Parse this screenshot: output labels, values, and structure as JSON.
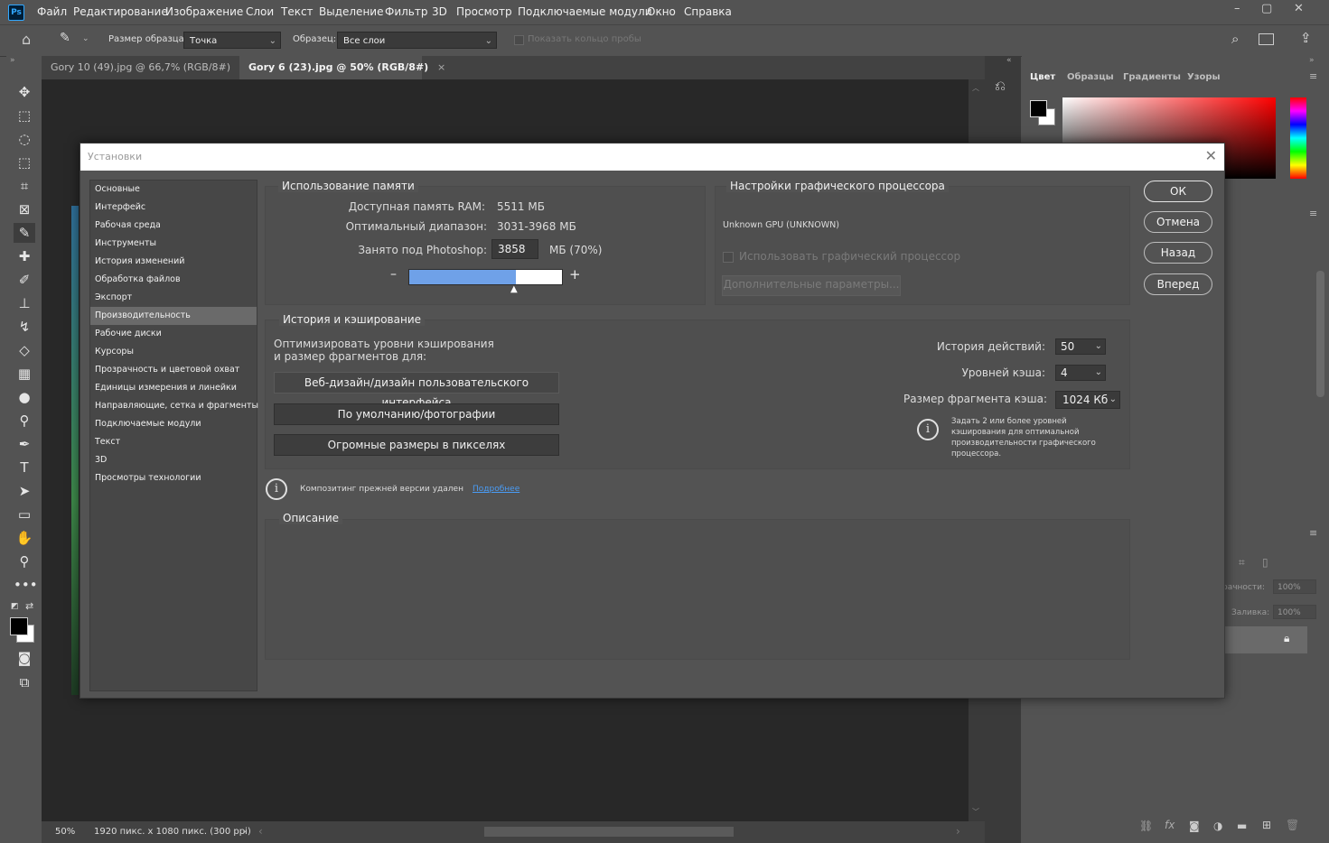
{
  "app": {
    "logo": "Ps",
    "menu": [
      "Файл",
      "Редактирование",
      "Изображение",
      "Слои",
      "Текст",
      "Выделение",
      "Фильтр",
      "3D",
      "Просмотр",
      "Подключаемые модули",
      "Окно",
      "Справка"
    ],
    "window_controls": [
      "–",
      "▢",
      "✕"
    ]
  },
  "options_bar": {
    "sample_size_label": "Размер образца:",
    "sample_size_value": "Точка",
    "sample_label": "Образец:",
    "sample_value": "Все слои",
    "show_ring_label": "Показать кольцо пробы"
  },
  "tabs": [
    {
      "label": "Gory 10 (49).jpg @ 66,7% (RGB/8#)",
      "active": false
    },
    {
      "label": "Gory 6 (23).jpg @ 50% (RGB/8#)",
      "active": true
    }
  ],
  "status_bar": {
    "zoom": "50%",
    "doc_info": "1920 пикс. x 1080 пикс. (300 ppi)"
  },
  "panels": {
    "color_tabs": [
      "Цвет",
      "Образцы",
      "Градиенты",
      "Узоры"
    ],
    "layers_opacity_label": "рачности:",
    "layers_opacity_value": "100%",
    "layers_fill_label": "Заливка:",
    "layers_fill_value": "100%"
  },
  "dialog": {
    "title": "Установки",
    "nav": [
      "Основные",
      "Интерфейс",
      "Рабочая среда",
      "Инструменты",
      "История изменений",
      "Обработка файлов",
      "Экспорт",
      "Производительность",
      "Рабочие диски",
      "Курсоры",
      "Прозрачность и цветовой охват",
      "Единицы измерения и линейки",
      "Направляющие, сетка и фрагменты",
      "Подключаемые модули",
      "Текст",
      "3D",
      "Просмотры технологии"
    ],
    "active_nav": "Производительность",
    "memory": {
      "title": "Использование памяти",
      "ram_label": "Доступная память RAM:",
      "ram_value": "5511 МБ",
      "range_label": "Оптимальный диапазон:",
      "range_value": "3031-3968 МБ",
      "used_label": "Занято под Photoshop:",
      "used_value": "3858",
      "used_unit": "МБ (70%)",
      "used_percent": 70,
      "minus": "–",
      "plus": "+"
    },
    "gpu": {
      "title": "Настройки графического процессора",
      "gpu_name": "Unknown GPU (UNKNOWN)",
      "use_gpu_label": "Использовать графический процессор",
      "advanced_label": "Дополнительные параметры..."
    },
    "history": {
      "title": "История и кэширование",
      "optimize_line1": "Оптимизировать уровни кэширования",
      "optimize_line2": "и размер фрагментов для:",
      "preset_buttons": [
        "Веб-дизайн/дизайн пользовательского интерфейса",
        "По умолчанию/фотографии",
        "Огромные размеры в пикселях"
      ],
      "history_states_label": "История действий:",
      "history_states_value": "50",
      "cache_levels_label": "Уровней кэша:",
      "cache_levels_value": "4",
      "tile_size_label": "Размер фрагмента кэша:",
      "tile_size_value": "1024 Кб",
      "hint": [
        "Задать 2 или более уровней",
        "кэширования для оптимальной",
        "производительности графического",
        "процессора."
      ]
    },
    "legacy_notice": "Композитинг прежней версии удален",
    "learn_more": "Подробнее",
    "description_title": "Описание",
    "buttons": {
      "ok": "ОК",
      "cancel": "Отмена",
      "prev": "Назад",
      "next": "Вперед"
    }
  }
}
